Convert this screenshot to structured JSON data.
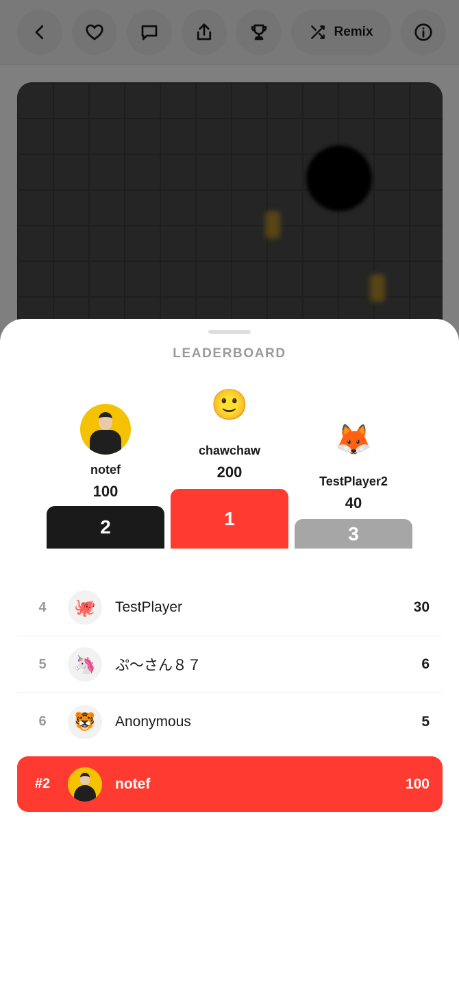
{
  "toolbar": {
    "remix_label": "Remix"
  },
  "leaderboard": {
    "title": "LEADERBOARD",
    "podium": {
      "first": {
        "name": "chawchaw",
        "score": "200",
        "rank": "1",
        "avatar": "🙂"
      },
      "second": {
        "name": "notef",
        "score": "100",
        "rank": "2",
        "avatar": "photo"
      },
      "third": {
        "name": "TestPlayer2",
        "score": "40",
        "rank": "3",
        "avatar": "🦊"
      }
    },
    "rows": [
      {
        "rank": "4",
        "avatar": "🐙",
        "name": "TestPlayer",
        "score": "30"
      },
      {
        "rank": "5",
        "avatar": "🦄",
        "name": "ぷ〜さん８７",
        "score": "6"
      },
      {
        "rank": "6",
        "avatar": "🐯",
        "name": "Anonymous",
        "score": "5"
      }
    ],
    "me": {
      "rank": "#2",
      "name": "notef",
      "score": "100",
      "avatar": "photo"
    }
  },
  "colors": {
    "accent": "#ff3a30",
    "second_block": "#1a1a1a",
    "third_block": "#a6a6a6"
  }
}
